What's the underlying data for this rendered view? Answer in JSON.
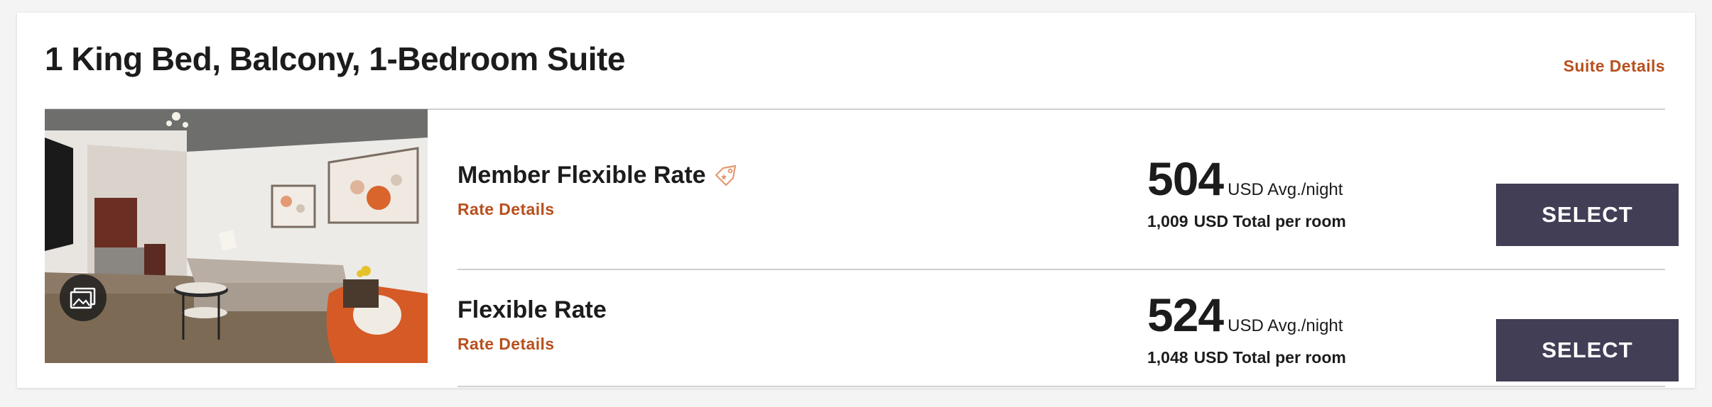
{
  "room": {
    "title": "1 King Bed, Balcony, 1-Bedroom Suite",
    "details_link": "Suite Details"
  },
  "colors": {
    "accent": "#b8501e",
    "button_bg": "#423e55",
    "text": "#1c1c1c",
    "divider": "#cfcfcf"
  },
  "photo": {
    "gallery_icon": "gallery-icon"
  },
  "rates": [
    {
      "name": "Member Flexible Rate",
      "badge_icon": "member-tag-icon",
      "details_link": "Rate Details",
      "avg_price": "504",
      "avg_label": "USD Avg./night",
      "total_price": "1,009",
      "total_label": "USD Total per room",
      "button": "SELECT"
    },
    {
      "name": "Flexible Rate",
      "details_link": "Rate Details",
      "avg_price": "524",
      "avg_label": "USD Avg./night",
      "total_price": "1,048",
      "total_label": "USD Total per room",
      "button": "SELECT"
    }
  ]
}
